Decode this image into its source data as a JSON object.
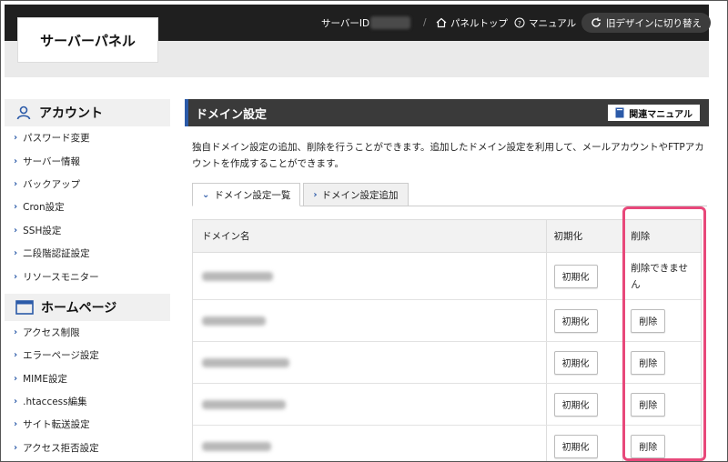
{
  "header": {
    "logo_text": "サーバーパネル",
    "server_id_label": "サーバーID",
    "divider": "/",
    "panel_top": "パネルトップ",
    "manual": "マニュアル",
    "old_design": "旧デザインに切り替え"
  },
  "sidebar": {
    "sections": [
      {
        "title": "アカウント",
        "icon": "user-icon",
        "items": [
          "パスワード変更",
          "サーバー情報",
          "バックアップ",
          "Cron設定",
          "SSH設定",
          "二段階認証設定",
          "リソースモニター"
        ]
      },
      {
        "title": "ホームページ",
        "icon": "window-icon",
        "items": [
          "アクセス制限",
          "エラーページ設定",
          "MIME設定",
          ".htaccess編集",
          "サイト転送設定",
          "アクセス拒否設定"
        ]
      }
    ]
  },
  "main": {
    "title": "ドメイン設定",
    "manual_button": "関連マニュアル",
    "description": "独自ドメイン設定の追加、削除を行うことができます。追加したドメイン設定を利用して、メールアカウントやFTPアカウントを作成することができます。",
    "tabs": [
      {
        "label": "ドメイン設定一覧",
        "active": true
      },
      {
        "label": "ドメイン設定追加",
        "active": false
      }
    ],
    "table": {
      "headers": [
        "ドメイン名",
        "初期化",
        "削除"
      ],
      "rows": [
        {
          "init": "初期化",
          "delete": "削除できません"
        },
        {
          "init": "初期化",
          "delete": "削除"
        },
        {
          "init": "初期化",
          "delete": "削除"
        },
        {
          "init": "初期化",
          "delete": "削除"
        },
        {
          "init": "初期化",
          "delete": "削除"
        }
      ]
    }
  },
  "colors": {
    "topbar": "#1f1f1f",
    "accent_blue": "#2b5aa8",
    "highlight": "#e8487a"
  }
}
